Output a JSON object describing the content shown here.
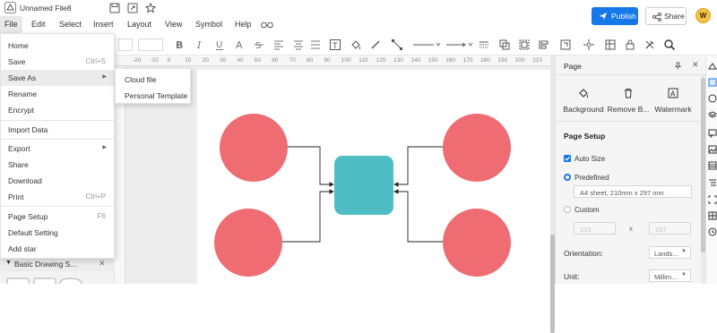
{
  "title_bar": {
    "file_name": "Unnamed File8"
  },
  "menubar": {
    "items": [
      "File",
      "Edit",
      "Select",
      "Insert",
      "Layout",
      "View",
      "Symbol",
      "Help"
    ],
    "publish_label": "Publish",
    "share_label": "Share",
    "avatar_initial": "W"
  },
  "colors": {
    "accent": "#1677e8",
    "circle": "#ee6c72",
    "rounded_square": "#4fbdc4"
  },
  "file_menu": {
    "items": [
      {
        "label": "Home",
        "shortcut": "",
        "submenu": false
      },
      {
        "label": "Save",
        "shortcut": "Ctrl+S",
        "submenu": false
      },
      {
        "label": "Save As",
        "shortcut": "",
        "submenu": true
      },
      {
        "label": "Rename",
        "shortcut": "",
        "submenu": false
      },
      {
        "label": "Encrypt",
        "shortcut": "",
        "submenu": false
      },
      {
        "label": "Import Data",
        "shortcut": "",
        "submenu": false
      },
      {
        "label": "Export",
        "shortcut": "",
        "submenu": true
      },
      {
        "label": "Share",
        "shortcut": "",
        "submenu": false
      },
      {
        "label": "Download",
        "shortcut": "",
        "submenu": false
      },
      {
        "label": "Print",
        "shortcut": "Ctrl+P",
        "submenu": false
      },
      {
        "label": "Page Setup",
        "shortcut": "F6",
        "submenu": false
      },
      {
        "label": "Default Setting",
        "shortcut": "",
        "submenu": false
      },
      {
        "label": "Add star",
        "shortcut": "",
        "submenu": false
      }
    ],
    "save_as_submenu": [
      "Cloud file",
      "Personal Template"
    ]
  },
  "left_panel": {
    "library_label": "Basic Drawing S..."
  },
  "ruler": {
    "ticks": [
      "-20",
      "-10",
      "0",
      "10",
      "20",
      "30",
      "40",
      "50",
      "60",
      "70",
      "80",
      "90",
      "100",
      "110",
      "120",
      "130",
      "140",
      "150",
      "160",
      "170",
      "180",
      "190",
      "200",
      "210",
      "220"
    ]
  },
  "right_panel": {
    "title": "Page",
    "actions": [
      {
        "label": "Background",
        "icon": "paint-bucket-icon"
      },
      {
        "label": "Remove B...",
        "icon": "trash-icon"
      },
      {
        "label": "Watermark",
        "icon": "watermark-icon"
      }
    ],
    "page_setup": {
      "section_title": "Page Setup",
      "auto_size_label": "Auto Size",
      "auto_size_checked": true,
      "predefined_label": "Predefined",
      "predefined_value": "A4 sheet, 210mm x 297 mm",
      "custom_label": "Custom",
      "custom_width": "210",
      "custom_height": "297",
      "x_separator": "x",
      "orientation_label": "Orientation:",
      "orientation_value": "Lands...",
      "unit_label": "Unit:",
      "unit_value": "Millim..."
    }
  }
}
